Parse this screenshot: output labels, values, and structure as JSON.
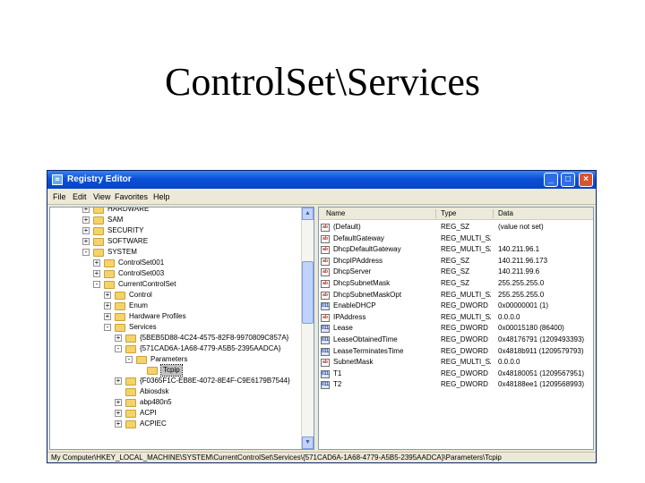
{
  "slide": {
    "title": "ControlSet\\Services"
  },
  "window": {
    "title": "Registry Editor",
    "controls": {
      "minimize": "_",
      "maximize": "□",
      "close": "×"
    }
  },
  "menu": [
    "File",
    "Edit",
    "View",
    "Favorites",
    "Help"
  ],
  "tree": [
    {
      "label": "HARDWARE",
      "expander": "+"
    },
    {
      "label": "SAM",
      "expander": "+"
    },
    {
      "label": "SECURITY",
      "expander": "+"
    },
    {
      "label": "SOFTWARE",
      "expander": "+"
    },
    {
      "label": "SYSTEM",
      "expander": "-"
    },
    {
      "label": "ControlSet001",
      "expander": "+"
    },
    {
      "label": "ControlSet003",
      "expander": "+"
    },
    {
      "label": "CurrentControlSet",
      "expander": "-"
    },
    {
      "label": "Control",
      "expander": "+"
    },
    {
      "label": "Enum",
      "expander": "+"
    },
    {
      "label": "Hardware Profiles",
      "expander": "+"
    },
    {
      "label": "Services",
      "expander": "-"
    },
    {
      "label": "{5BEB5D88-4C24-4575-82F8-9970809C857A}",
      "expander": "+"
    },
    {
      "label": "{571CAD6A-1A68-4779-A5B5-2395AADCA}",
      "expander": "-"
    },
    {
      "label": "Parameters",
      "expander": "-"
    },
    {
      "label": "Tcpip",
      "expander": ""
    },
    {
      "label": "{F0365F1C-EB8E-4072-8E4F-C9E6179B7544}",
      "expander": "+"
    },
    {
      "label": "Abiosdsk",
      "expander": ""
    },
    {
      "label": "abp480n5",
      "expander": "+"
    },
    {
      "label": "ACPI",
      "expander": "+"
    },
    {
      "label": "ACPIEC",
      "expander": "+"
    }
  ],
  "list": {
    "columns": [
      "Name",
      "Type",
      "Data"
    ],
    "rows": [
      {
        "icon": "ab",
        "name": "(Default)",
        "type": "REG_SZ",
        "data": "(value not set)"
      },
      {
        "icon": "ab",
        "name": "DefaultGateway",
        "type": "REG_MULTI_SZ",
        "data": ""
      },
      {
        "icon": "ab",
        "name": "DhcpDefaultGateway",
        "type": "REG_MULTI_SZ",
        "data": "140.211.96.1"
      },
      {
        "icon": "ab",
        "name": "DhcpIPAddress",
        "type": "REG_SZ",
        "data": "140.211.96.173"
      },
      {
        "icon": "ab",
        "name": "DhcpServer",
        "type": "REG_SZ",
        "data": "140.211.99.6"
      },
      {
        "icon": "ab",
        "name": "DhcpSubnetMask",
        "type": "REG_SZ",
        "data": "255.255.255.0"
      },
      {
        "icon": "ab",
        "name": "DhcpSubnetMaskOpt",
        "type": "REG_MULTI_SZ",
        "data": "255.255.255.0"
      },
      {
        "icon": "dw",
        "name": "EnableDHCP",
        "type": "REG_DWORD",
        "data": "0x00000001 (1)"
      },
      {
        "icon": "ab",
        "name": "IPAddress",
        "type": "REG_MULTI_SZ",
        "data": "0.0.0.0"
      },
      {
        "icon": "dw",
        "name": "Lease",
        "type": "REG_DWORD",
        "data": "0x00015180 (86400)"
      },
      {
        "icon": "dw",
        "name": "LeaseObtainedTime",
        "type": "REG_DWORD",
        "data": "0x48176791 (1209493393)"
      },
      {
        "icon": "dw",
        "name": "LeaseTerminatesTime",
        "type": "REG_DWORD",
        "data": "0x4818b911 (1209579793)"
      },
      {
        "icon": "ab",
        "name": "SubnetMask",
        "type": "REG_MULTI_SZ",
        "data": "0.0.0.0"
      },
      {
        "icon": "dw",
        "name": "T1",
        "type": "REG_DWORD",
        "data": "0x48180051 (1209567951)"
      },
      {
        "icon": "dw",
        "name": "T2",
        "type": "REG_DWORD",
        "data": "0x48188ee1 (1209568993)"
      }
    ]
  },
  "status": "My Computer\\HKEY_LOCAL_MACHINE\\SYSTEM\\CurrentControlSet\\Services\\{571CAD6A-1A68-4779-A5B5-2395AADCA}\\Parameters\\Tcpip"
}
